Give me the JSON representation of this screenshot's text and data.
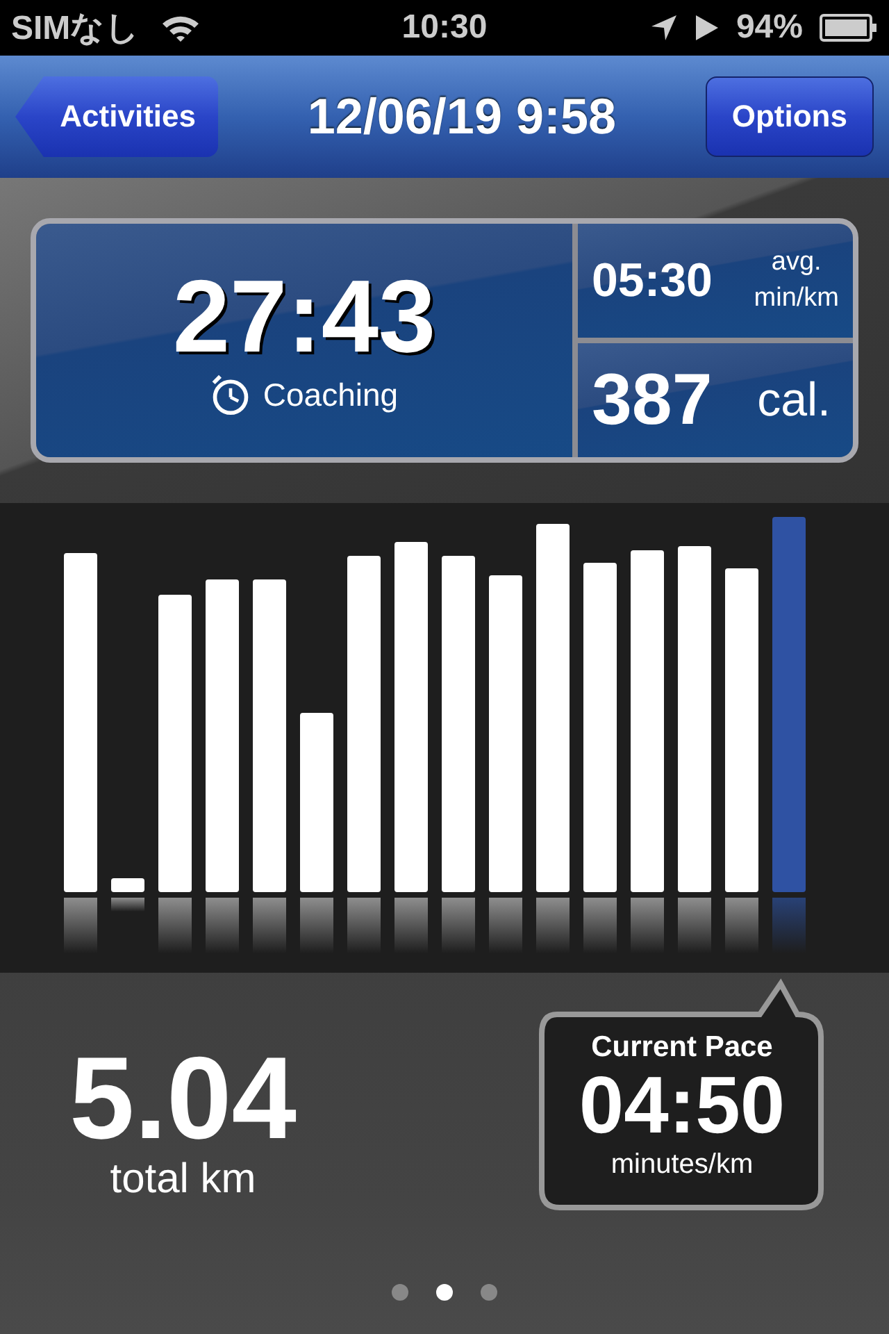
{
  "status_bar": {
    "carrier": "SIMなし",
    "time": "10:30",
    "battery": "94%"
  },
  "nav": {
    "back": "Activities",
    "title": "12/06/19 9:58",
    "action": "Options"
  },
  "summary": {
    "duration": "27:43",
    "coaching": "Coaching",
    "avg_pace": "05:30",
    "avg_label": "avg.",
    "avg_unit": "min/km",
    "calories": "387",
    "calories_unit": "cal."
  },
  "distance": {
    "value": "5.04",
    "unit": "total km"
  },
  "current_pace": {
    "label": "Current Pace",
    "value": "04:50",
    "unit": "minutes/km"
  },
  "pages": [
    {
      "selected": false
    },
    {
      "selected": true
    },
    {
      "selected": false
    }
  ]
}
